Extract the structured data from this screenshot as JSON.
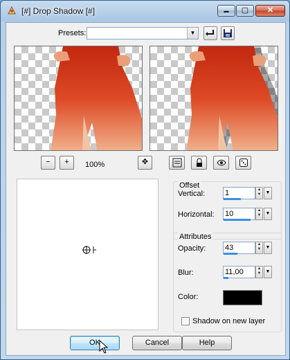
{
  "window": {
    "title": "[#] Drop Shadow [#]",
    "caption_buttons": {
      "minimize": "▬",
      "maximize": "▢",
      "close": "✕"
    }
  },
  "presets": {
    "label": "Presets:",
    "value": ""
  },
  "toolbar": {
    "reset_icon": "reset-icon",
    "save_icon": "save-icon"
  },
  "preview": {
    "zoom_out_label": "−",
    "zoom_in_label": "+",
    "zoom_level": "100%",
    "pan_label": "✥"
  },
  "offset": {
    "title": "Offset",
    "vertical": {
      "label": "Vertical:",
      "value": "1",
      "fill": 0.55
    },
    "horizontal": {
      "label": "Horizontal:",
      "value": "10",
      "fill": 0.85
    }
  },
  "attributes": {
    "title": "Attributes",
    "opacity": {
      "label": "Opacity:",
      "value": "43",
      "fill": 0.43
    },
    "blur": {
      "label": "Blur:",
      "value": "11,00",
      "fill": 0.15
    },
    "color": {
      "label": "Color:",
      "value": "#000000"
    }
  },
  "shadow_on_new_layer": {
    "label": "Shadow on new layer",
    "checked": false
  },
  "buttons": {
    "ok": "OK",
    "cancel": "Cancel",
    "help": "Help"
  },
  "colors": {
    "accent": "#3a8ee6",
    "dress_red": "#d73a1c"
  }
}
